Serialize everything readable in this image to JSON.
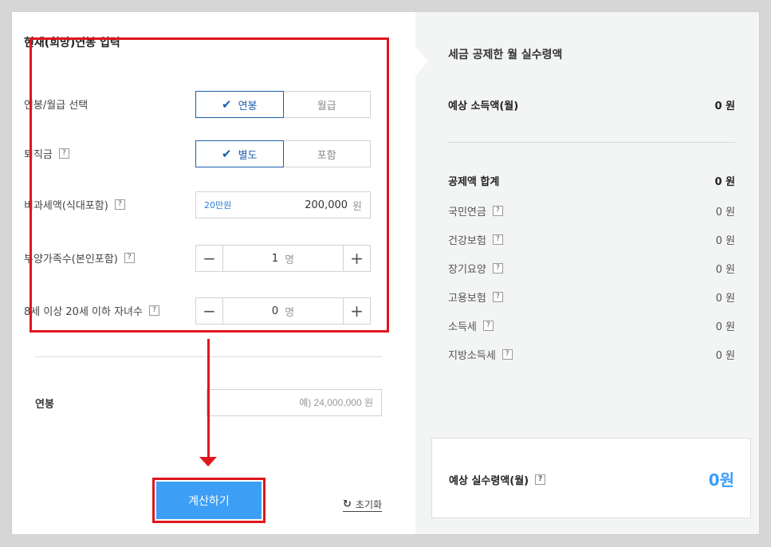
{
  "form": {
    "title": "현재(희망)연봉 입력",
    "pay_type": {
      "label": "연봉/월급 선택",
      "options": [
        "연봉",
        "월급"
      ],
      "selected": "연봉"
    },
    "severance": {
      "label": "퇴직금",
      "help": "?",
      "options": [
        "별도",
        "포함"
      ],
      "selected": "별도"
    },
    "nontaxable": {
      "label": "비과세액(식대포함)",
      "help": "?",
      "hint": "20만원",
      "value": "200,000",
      "unit": "원"
    },
    "dependents": {
      "label": "부양가족수(본인포함)",
      "help": "?",
      "value": "1",
      "unit": "명"
    },
    "children": {
      "label": "8세 이상 20세 이하 자녀수",
      "help": "?",
      "value": "0",
      "unit": "명"
    },
    "salary": {
      "label": "연봉",
      "placeholder": "예) 24,000,000 원"
    },
    "calc_button": "계산하기",
    "reset_link": "초기화"
  },
  "result": {
    "title": "세금 공제한 월 실수령액",
    "monthly_income": {
      "label": "예상 소득액(월)",
      "amount": "0 원"
    },
    "deduction_total": {
      "label": "공제액 합계",
      "amount": "0 원"
    },
    "items": [
      {
        "label": "국민연금",
        "help": "?",
        "amount": "0 원"
      },
      {
        "label": "건강보험",
        "help": "?",
        "amount": "0 원"
      },
      {
        "label": "장기요양",
        "help": "?",
        "amount": "0 원"
      },
      {
        "label": "고용보험",
        "help": "?",
        "amount": "0 원"
      },
      {
        "label": "소득세",
        "help": "?",
        "amount": "0 원"
      },
      {
        "label": "지방소득세",
        "help": "?",
        "amount": "0 원"
      }
    ],
    "net_pay": {
      "label": "예상 실수령액(월)",
      "help": "?",
      "amount": "0원"
    }
  },
  "colors": {
    "accent": "#3d9ef6",
    "selected": "#1c5fa8",
    "highlight": "#e0161d"
  }
}
